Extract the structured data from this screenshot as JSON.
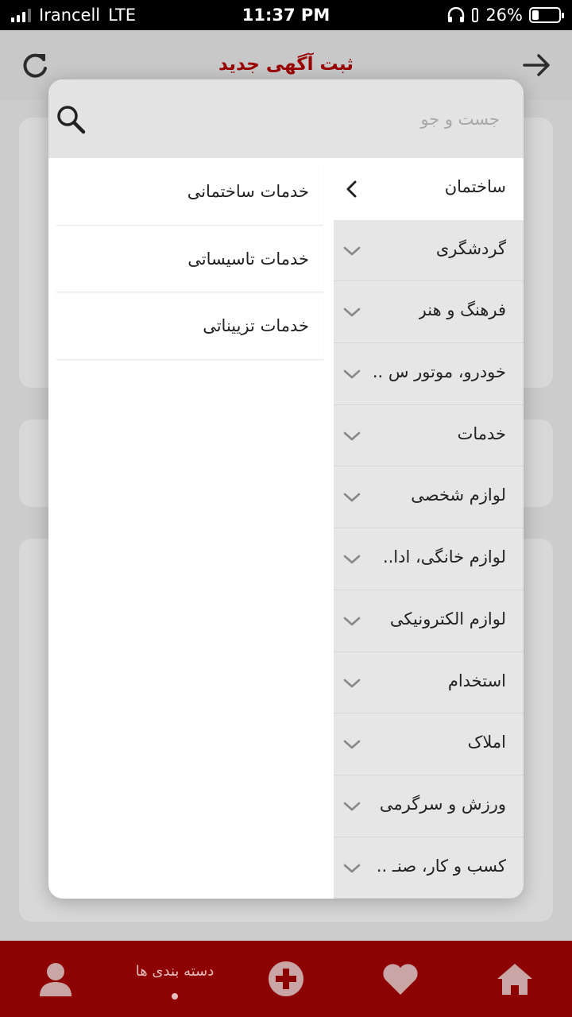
{
  "status_bar": {
    "carrier": "Irancell",
    "network": "LTE",
    "time": "11:37 PM",
    "battery": "26%",
    "battery_level": 0.26
  },
  "header": {
    "title": "ثبت آگهی جدید"
  },
  "search": {
    "placeholder": "جست و جو",
    "value": ""
  },
  "categories": [
    {
      "label": "ساختمان",
      "active": true
    },
    {
      "label": "گردشگری"
    },
    {
      "label": "فرهنگ و هنر"
    },
    {
      "label": "خودرو، موتور س .."
    },
    {
      "label": "خدمات"
    },
    {
      "label": "لوازم شخصی"
    },
    {
      "label": "لوازم خانگی، ادا.."
    },
    {
      "label": "لوازم الکترونیکی"
    },
    {
      "label": "استخدام"
    },
    {
      "label": "املاک"
    },
    {
      "label": "ورزش و سرگرمی"
    },
    {
      "label": "کسب و کار، صنـ .."
    }
  ],
  "subcategories": [
    {
      "label": "خدمات ساختمانی"
    },
    {
      "label": "خدمات تاسیساتی"
    },
    {
      "label": "خدمات تزییناتی"
    }
  ],
  "bottom_nav": {
    "categories_label": "دسته بندی ها"
  },
  "colors": {
    "brand_red": "#8d0303",
    "title_red": "#b00000"
  }
}
